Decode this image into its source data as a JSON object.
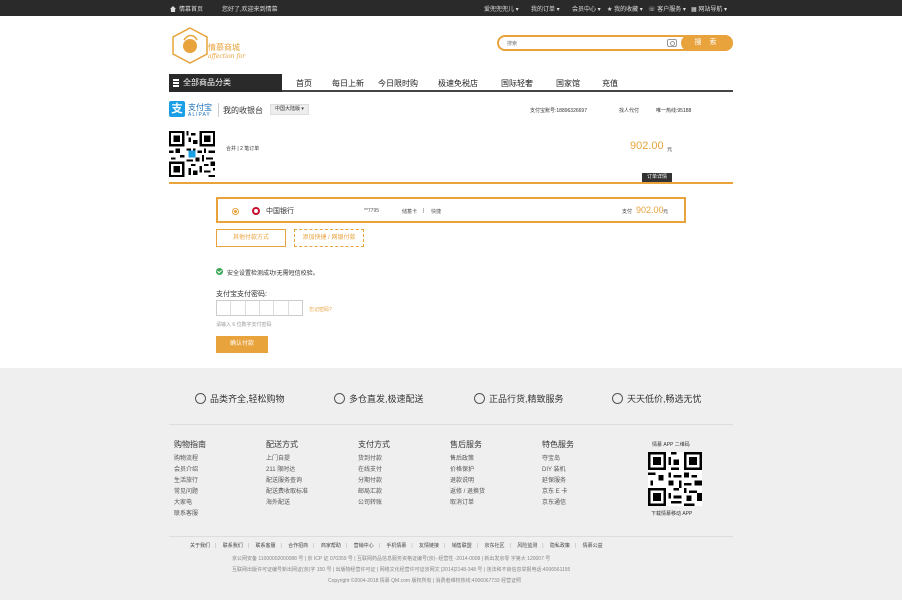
{
  "topbar": {
    "home": "情慕首页",
    "welcome": "您好了,欢迎来到情慕",
    "user": "爱兜兜兜儿",
    "orders": "我的订单",
    "member": "会员中心",
    "favorites": "我的收藏",
    "service": "客户服务",
    "sitemap": "网站导航"
  },
  "header": {
    "logo_text": "情慕商城",
    "logo_sub": "affection for",
    "search_placeholder": "搜索",
    "search_btn": "搜 索"
  },
  "nav": {
    "all_categories": "全部商品分类",
    "links": [
      "首页",
      "每日上新",
      "今日限时购",
      "极速免税店",
      "国际轻奢",
      "国家馆",
      "充值"
    ]
  },
  "cashier": {
    "alipay_cn": "支付宝",
    "alipay_en": "ALIPAY",
    "title": "我的收银台",
    "region": "中国大陆版",
    "account_label": "支付宝账号:18896326697",
    "proxy_pay": "找人代付",
    "hotline": "唯一热线:95188",
    "total_text": "合并 | 2 笔订单",
    "amount": "902.00",
    "unit": "元",
    "detail_btn": "订单详情"
  },
  "payment": {
    "bank": "中国银行",
    "card_no": "**7795",
    "card_type": "储蓄卡",
    "sep": "|",
    "fast": "快捷",
    "pay_label": "支付",
    "pay_amount": "902.00",
    "pay_unit": "元",
    "other_btn": "其他付款方式",
    "add_btn": "添加快捷 / 网银付款",
    "safe_text": "安全设置检测成功!无需短信校验。",
    "pwd_label": "支付宝支付密码:",
    "forgot": "忘记密码?",
    "pwd_hint": "请输入 6 位数字支付密码",
    "confirm_btn": "确认付款"
  },
  "footer": {
    "promos": [
      "品类齐全,轻松购物",
      "多仓直发,极速配送",
      "正品行货,精致服务",
      "天天低价,畅选无忧"
    ],
    "columns": [
      {
        "title": "购物指南",
        "items": [
          "购物流程",
          "会员介绍",
          "生活旅行",
          "常见问题",
          "大家电",
          "联系客服"
        ]
      },
      {
        "title": "配送方式",
        "items": [
          "上门自提",
          "211 限时达",
          "配送服务查询",
          "配送费收取标准",
          "海外配送"
        ]
      },
      {
        "title": "支付方式",
        "items": [
          "货到付款",
          "在线支付",
          "分期付款",
          "邮局汇款",
          "公司转账"
        ]
      },
      {
        "title": "售后服务",
        "items": [
          "售后政策",
          "价格保护",
          "退款说明",
          "返修 / 退换货",
          "取消订单"
        ]
      },
      {
        "title": "特色服务",
        "items": [
          "夺宝岛",
          "DIY 装机",
          "延保服务",
          "京东 E 卡",
          "京东通信"
        ]
      }
    ],
    "app_title": "情慕 APP 二维码",
    "app_sub": "下载情慕移动 APP",
    "links": [
      "关于我们",
      "联系我们",
      "联系客服",
      "合作招商",
      "商家帮助",
      "营销中心",
      "手机情慕",
      "友情链接",
      "销售联盟",
      "京东社区",
      "风险监测",
      "隐私政策",
      "情慕公益"
    ],
    "line1": "京公网安备 11000002000088 号  |  京 ICP 证 070359 号  |  互联网药品信息服务资格证编号(京)- 经营性 -2014-0008  |  新出发京零 字第大 120007 号",
    "line2": "互联网出版许可证编号新出网证(京)字 150 号  |  出版物经营许可证  |  网络文化经营许可证京网文 [2014]2148-348 号  |  违法和不良信息举报电话:4006561155",
    "line3": "Copyright ©2004-2018  情慕 QM.com 版权所有  |  消费者维权热线:4006067733  经营证照"
  }
}
